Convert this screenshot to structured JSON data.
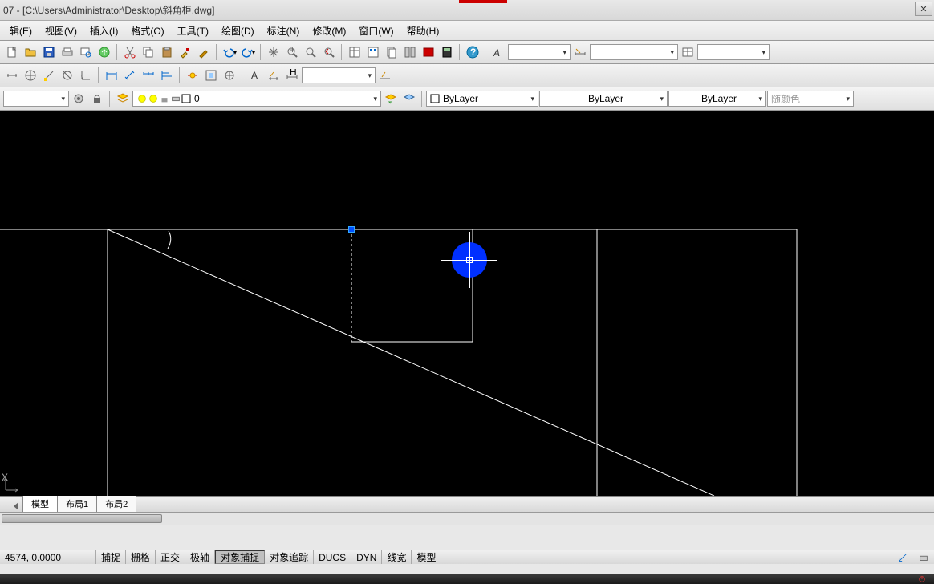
{
  "title": "07 - [C:\\Users\\Administrator\\Desktop\\斜角柜.dwg]",
  "menu": [
    "辑(E)",
    "视图(V)",
    "插入(I)",
    "格式(O)",
    "工具(T)",
    "绘图(D)",
    "标注(N)",
    "修改(M)",
    "窗口(W)",
    "帮助(H)"
  ],
  "toolbar1_icons": [
    "new",
    "open",
    "save",
    "plot",
    "preview",
    "publish",
    "",
    "cut",
    "copy",
    "paste",
    "match",
    "brush",
    "",
    "undo",
    "redo",
    "",
    "pan",
    "zoom-rt",
    "zoom-win",
    "zoom-prev",
    "",
    "props",
    "dc",
    "sheet",
    "tool-pal",
    "markup",
    "",
    "render",
    "calc",
    "",
    "help"
  ],
  "toolbar2_icons": [
    "dist",
    "ucs",
    "osnap",
    "ucs2",
    "angle",
    "",
    "dim-lin",
    "dim-ali",
    "dim-cont",
    "dim-base",
    "",
    "quick",
    "multi",
    "table",
    "",
    "text",
    "mtext",
    "leader"
  ],
  "layer_combo": "0",
  "color_combo": "ByLayer",
  "linetype_combo": "ByLayer",
  "lineweight_combo": "ByLayer",
  "plotstyle_combo": "随颜色",
  "tabs": [
    "模型",
    "布局1",
    "布局2"
  ],
  "active_tab": 0,
  "coords": "4574, 0.0000",
  "status_buttons": [
    "捕捉",
    "栅格",
    "正交",
    "极轴",
    "对象捕捉",
    "对象追踪",
    "DUCS",
    "DYN",
    "线宽",
    "模型"
  ],
  "ucs_labels": {
    "x": "X",
    "y": ""
  },
  "colors": {
    "accent": "#0030ff",
    "canvas": "#000000"
  }
}
